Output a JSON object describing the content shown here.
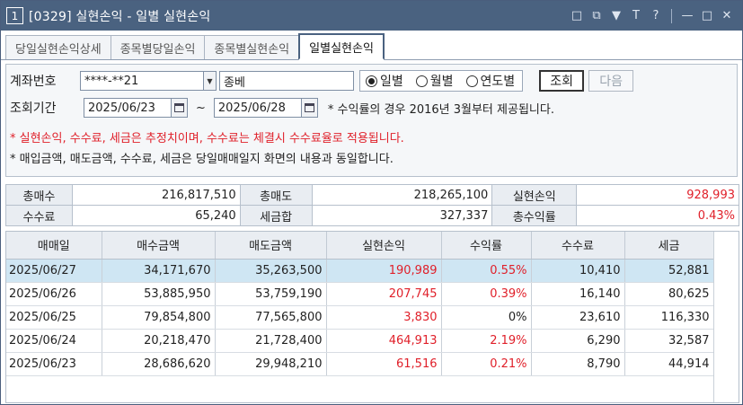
{
  "window": {
    "number": "1",
    "title": "[0329] 실현손익 - 일별 실현손익",
    "controls": [
      "□",
      "⧉",
      "▼",
      "T",
      "?",
      "—",
      "□",
      "✕"
    ]
  },
  "tabs": [
    {
      "label": "당일실현손익상세",
      "active": false
    },
    {
      "label": "종목별당일손익",
      "active": false
    },
    {
      "label": "종목별실현손익",
      "active": false
    },
    {
      "label": "일별실현손익",
      "active": true
    }
  ],
  "form": {
    "account_label": "계좌번호",
    "account_value": "****-**21",
    "account_type": "종베",
    "radios": [
      {
        "label": "일별",
        "checked": true
      },
      {
        "label": "월별",
        "checked": false
      },
      {
        "label": "연도별",
        "checked": false
      }
    ],
    "query_button": "조회",
    "next_button": "다음",
    "period_label": "조회기간",
    "date_from": "2025/06/23",
    "date_sep": "~",
    "date_to": "2025/06/28",
    "period_note": "* 수익률의 경우 2016년 3월부터 제공됩니다.",
    "note_red": "* 실현손익, 수수료, 세금은 추정치이며, 수수료는 체결시 수수료율로 적용됩니다.",
    "note_black": "* 매입금액, 매도금액, 수수료, 세금은 당일매매일지 화면의 내용과 동일합니다."
  },
  "summary": {
    "total_buy_label": "총매수",
    "total_buy": "216,817,510",
    "total_sell_label": "총매도",
    "total_sell": "218,265,100",
    "realized_label": "실현손익",
    "realized": "928,993",
    "fee_label": "수수료",
    "fee": "65,240",
    "tax_label": "세금합",
    "tax": "327,337",
    "return_label": "총수익률",
    "return": "0.43%"
  },
  "grid": {
    "headers": [
      "매매일",
      "매수금액",
      "매도금액",
      "실현손익",
      "수익률",
      "수수료",
      "세금"
    ],
    "rows": [
      {
        "date": "2025/06/27",
        "buy": "34,171,670",
        "sell": "35,263,500",
        "pnl": "190,989",
        "rate": "0.55%",
        "fee": "10,410",
        "tax": "52,881"
      },
      {
        "date": "2025/06/26",
        "buy": "53,885,950",
        "sell": "53,759,190",
        "pnl": "207,745",
        "rate": "0.39%",
        "fee": "16,140",
        "tax": "80,625"
      },
      {
        "date": "2025/06/25",
        "buy": "79,854,800",
        "sell": "77,565,800",
        "pnl": "3,830",
        "rate": "0%",
        "fee": "23,610",
        "tax": "116,330"
      },
      {
        "date": "2025/06/24",
        "buy": "20,218,470",
        "sell": "21,728,400",
        "pnl": "464,913",
        "rate": "2.19%",
        "fee": "6,290",
        "tax": "32,587"
      },
      {
        "date": "2025/06/23",
        "buy": "28,686,620",
        "sell": "29,948,210",
        "pnl": "61,516",
        "rate": "0.21%",
        "fee": "8,790",
        "tax": "44,914"
      }
    ]
  },
  "colors": {
    "titlebar": "#4a6280",
    "profit": "#e0202a",
    "selected_row": "#cfe6f3"
  }
}
